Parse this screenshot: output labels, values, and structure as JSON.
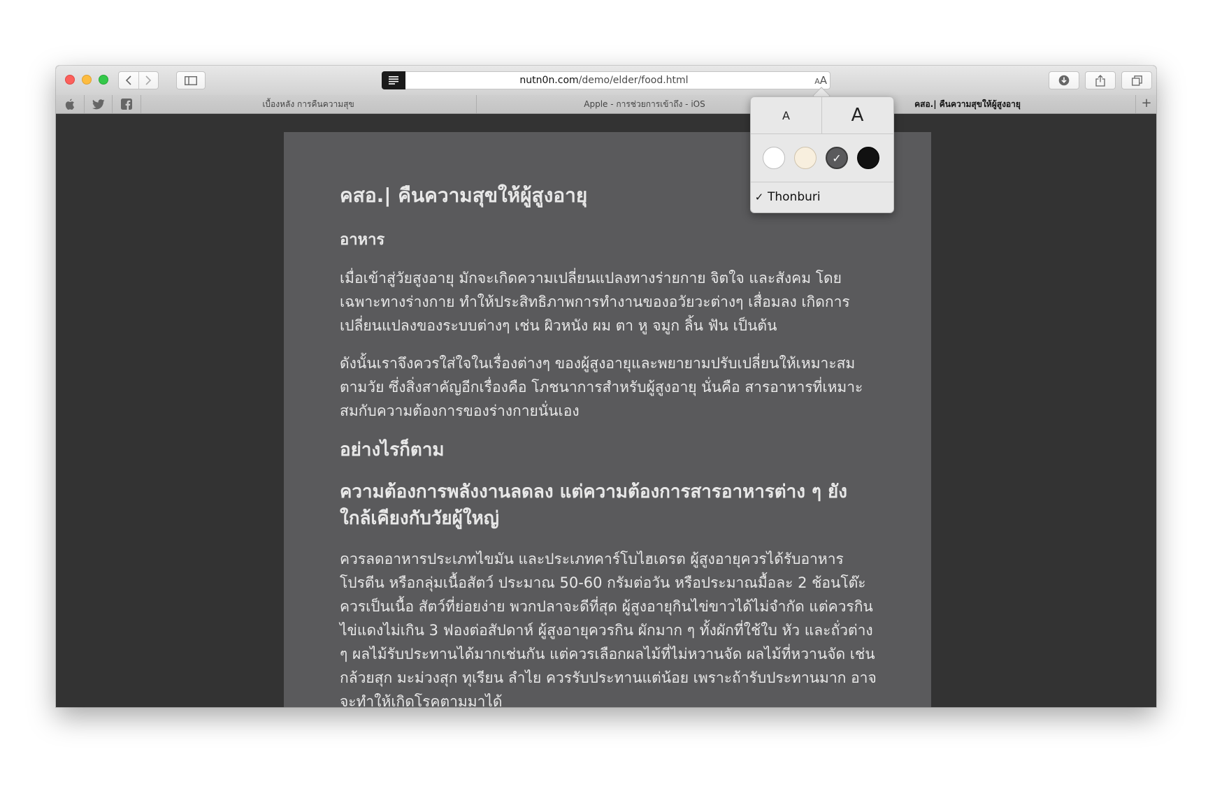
{
  "browser": {
    "url_host": "nutn0n.com",
    "url_path": "/demo/elder/food.html",
    "aa_small": "A",
    "aa_large": "A"
  },
  "bookmarks": {
    "icons": [
      "apple-icon",
      "twitter-icon",
      "facebook-icon"
    ]
  },
  "tabs": [
    {
      "label": "เบื้องหลัง การคืนความสุข"
    },
    {
      "label": "Apple - การช่วยการเข้าถึง - iOS"
    },
    {
      "label": "คสอ.| คืนความสุขให้ผู้สูงอายุ"
    }
  ],
  "new_tab_label": "+",
  "article": {
    "title": "คสอ.| คืนความสุขให้ผู้สูงอายุ",
    "section": "อาหาร",
    "para1": "เมื่อเข้าสู่วัยสูงอายุ มักจะเกิดความเปลี่ยนแปลงทางร่ายกาย จิตใจ และสังคม โดยเฉพาะทางร่างกาย ทำให้ประสิทธิภาพการทำงานของอวัยวะต่างๆ เสื่อมลง เกิดการเปลี่ยนแปลงของระบบต่างๆ เช่น ผิวหนัง ผม ตา หู จมูก ลิ้น ฟัน เป็นต้น",
    "para2": "ดังนั้นเราจึงควรใส่ใจในเรื่องต่างๆ ของผู้สูงอายุและพยายามปรับเปลี่ยนให้เหมาะสมตามวัย ซึ่งสิ่งสาคัญอีกเรื่องคือ โภชนาการสำหรับผู้สูงอายุ นั่นคือ สารอาหารที่เหมาะสมกับความต้องการของร่างกายนั่นเอง",
    "heading2": "อย่างไรก็ตาม",
    "heading3": "ความต้องการพลังงานลดลง แต่ความต้องการสารอาหารต่าง ๆ ยังใกล้เคียงกับวัยผู้ใหญ่",
    "para3": "ควรลดอาหารประเภทไขมัน และประเภทคาร์โบไฮเดรต ผู้สูงอายุควรได้รับอาหารโปรตีน หรือกลุ่มเนื้อสัตว์ ประมาณ 50-60 กรัมต่อวัน หรือประมาณมื้อละ 2 ช้อนโต๊ะ ควรเป็นเนื้อ สัตว์ที่ย่อยง่าย พวกปลาจะดีที่สุด ผู้สูงอายุกินไข่ขาวได้ไม่จำกัด แต่ควรกินไข่แดงไม่เกิน 3 ฟองต่อสัปดาห์ ผู้สูงอายุควรกิน ผักมาก ๆ ทั้งผักที่ใช้ใบ หัว และถั่วต่าง ๆ ผลไม้รับประทานได้มากเช่นกัน แต่ควรเลือกผลไม้ที่ไม่หวานจัด ผลไม้ที่หวานจัด เช่น กล้วยสุก มะม่วงสุก ทุเรียน ลำไย ควรรับประทานแต่น้อย เพราะถ้ารับประทานมาก อาจจะทำให้เกิดโรคตามมาได้"
  },
  "reader_popover": {
    "size_small_label": "A",
    "size_large_label": "A",
    "themes": [
      {
        "name": "white",
        "color": "#ffffff",
        "selected": false
      },
      {
        "name": "sepia",
        "color": "#f8efde",
        "selected": false
      },
      {
        "name": "gray",
        "color": "#5a5a5c",
        "selected": true
      },
      {
        "name": "night",
        "color": "#111111",
        "selected": false
      }
    ],
    "selected_check": "✓",
    "font_check": "✓",
    "font_name": "Thonburi"
  },
  "colors": {
    "reader_background": "#5a5a5c",
    "reader_text": "#e8e8e8",
    "window_background": "#333333"
  }
}
